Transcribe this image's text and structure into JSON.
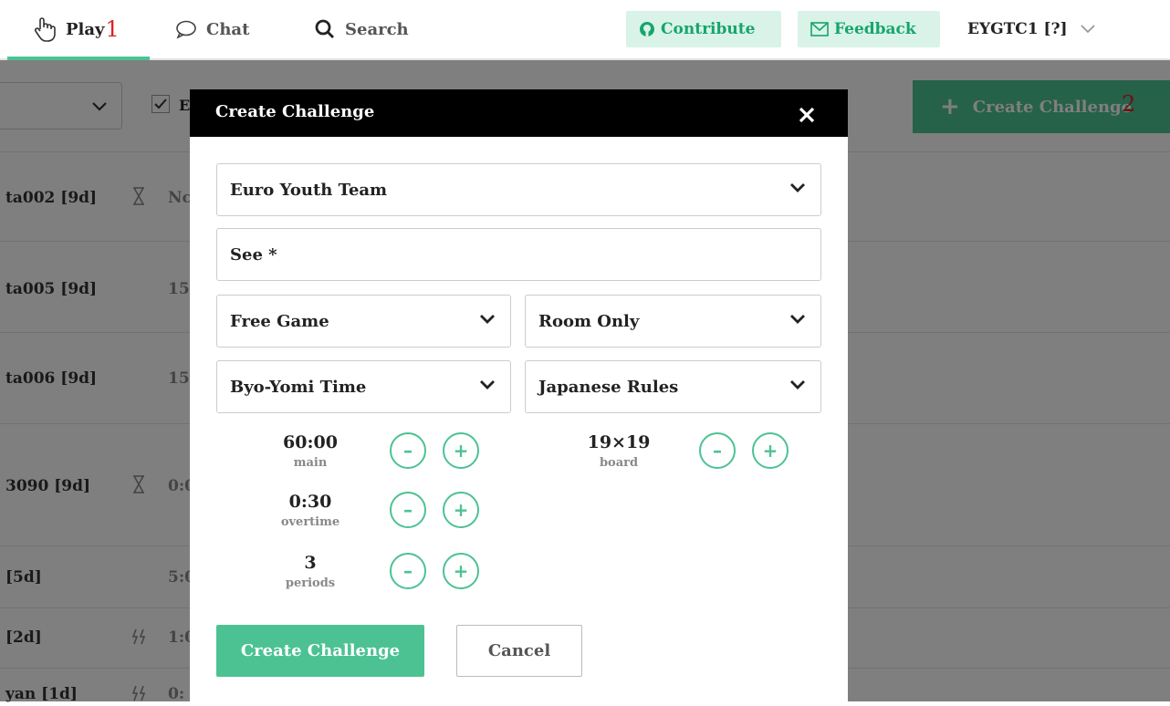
{
  "nav": {
    "play_label": "Play",
    "play_badge": "1",
    "chat_label": "Chat",
    "search_label": "Search",
    "contribute_label": "Contribute",
    "feedback_label": "Feedback",
    "user_label": "EYGTC1 [?]"
  },
  "background": {
    "check_label": "E",
    "create_label": "Create Challenge",
    "create_badge": "2",
    "rows": [
      {
        "name": "ta002 [9d]",
        "icon": "hourglass-icon",
        "value": "Nc"
      },
      {
        "name": "ta005 [9d]",
        "icon": "",
        "value": "15"
      },
      {
        "name": "ta006 [9d]",
        "icon": "",
        "value": "15"
      },
      {
        "name": "3090 [9d]",
        "icon": "hourglass-icon",
        "value": "0:0"
      },
      {
        "name": "[5d]",
        "icon": "",
        "value": "5:0"
      },
      {
        "name": "[2d]",
        "icon": "lightning-icon",
        "value": "1:0"
      },
      {
        "name": "yan [1d]",
        "icon": "lightning-icon",
        "value": "0:"
      }
    ]
  },
  "modal": {
    "title": "Create Challenge",
    "room_select": "Euro Youth Team",
    "note_input": "See *",
    "game_type_select": "Free Game",
    "visibility_select": "Room Only",
    "time_system_select": "Byo-Yomi Time",
    "rules_select": "Japanese Rules",
    "main_time": {
      "value": "60:00",
      "label": "main"
    },
    "overtime": {
      "value": "0:30",
      "label": "overtime"
    },
    "periods": {
      "value": "3",
      "label": "periods"
    },
    "board": {
      "value": "19×19",
      "label": "board"
    },
    "minus_glyph": "–",
    "plus_glyph": "+",
    "create_button": "Create Challenge",
    "cancel_button": "Cancel"
  },
  "colors": {
    "accent": "#4cc293",
    "pill_bg": "#d9f3e8",
    "header_bg": "#000000",
    "badge_red": "#e02020"
  }
}
